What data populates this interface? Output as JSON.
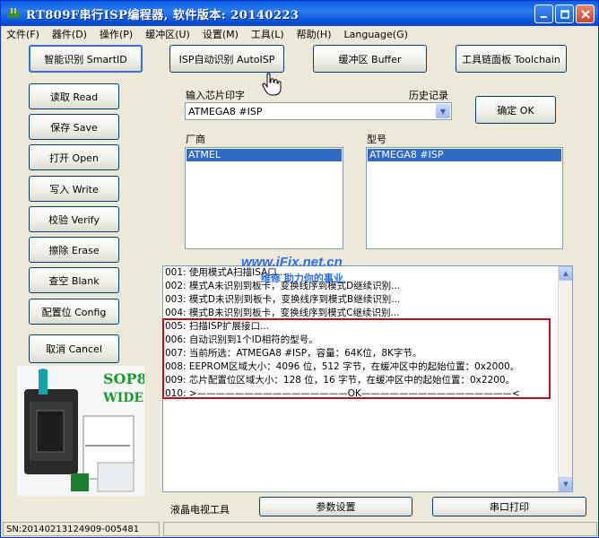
{
  "window": {
    "title": "RT809F串行ISP编程器, 软件版本: 20140223"
  },
  "menu": [
    "文件(F)",
    "器件(D)",
    "操作(P)",
    "缓冲区(U)",
    "设置(M)",
    "工具(L)",
    "帮助(H)",
    "Language(G)"
  ],
  "toolbar": {
    "smartid": "智能识别 SmartID",
    "autoisp": "ISP自动识别 AutoISP",
    "buffer": "缓冲区 Buffer",
    "toolchain": "工具链面板 Toolchain"
  },
  "side": {
    "read": "读取 Read",
    "save": "保存 Save",
    "open": "打开 Open",
    "write": "写入 Write",
    "verify": "校验 Verify",
    "erase": "擦除 Erase",
    "blank": "查空 Blank",
    "config": "配置位 Config",
    "cancel": "取消 Cancel"
  },
  "chip": {
    "input_label": "输入芯片印字",
    "history_label": "历史记录",
    "input_value": "ATMEGA8 #ISP",
    "ok": "确定 OK",
    "vendor_label": "厂商",
    "model_label": "型号",
    "vendor_selected": "ATMEL",
    "model_selected": "ATMEGA8 #ISP"
  },
  "socket": {
    "line1": "SOP8",
    "line2": "WIDE"
  },
  "watermark": {
    "site": "www.iFix.net.cn",
    "slogan": "维修 助力你的事业"
  },
  "log": [
    "001: 使用模式A扫描ISA口...",
    "002: 模式A未识别到板卡，变换线序到模式D继续识别...",
    "003: 模式D未识别到板卡，变换线序到模式B继续识别...",
    "004: 模式B未识别到板卡，变换线序到模式C继续识别...",
    "005: 扫描ISP扩展接口...",
    "006: 自动识别到1个ID相符的型号。",
    "007: 当前所选：ATMEGA8 #ISP，容量：64K位，8K字节。",
    "008: EEPROM区域大小：4096 位，512 字节，在缓冲区中的起始位置：0x2000。",
    "009: 芯片配置位区域大小：128 位，16 字节，在缓冲区中的起始位置：0x2200。",
    "010: >————————————————OK————————————————<"
  ],
  "bottom": {
    "lcd_tool": "液晶电视工具",
    "params": "参数设置",
    "serial_print": "串口打印"
  },
  "status": {
    "sn": "SN:20140213124909-005481"
  },
  "colors": {
    "selection": "#316ac5",
    "highlight_border": "#b0121c",
    "watermark": "#2c6ee8"
  }
}
